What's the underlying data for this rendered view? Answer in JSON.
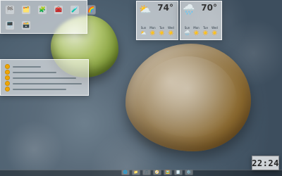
{
  "desktop": {
    "wallpaper": "river-stones"
  },
  "shortcuts": [
    {
      "icon": "🏁",
      "name": "app-icon-1"
    },
    {
      "icon": "🗂️",
      "name": "app-icon-2"
    },
    {
      "icon": "🧩",
      "name": "app-icon-3"
    },
    {
      "icon": "🧰",
      "name": "app-icon-4"
    },
    {
      "icon": "🧪",
      "name": "app-icon-5"
    },
    {
      "icon": "🌈",
      "name": "app-icon-6"
    },
    {
      "icon": "🖥️",
      "name": "app-icon-7"
    },
    {
      "icon": "🗃️",
      "name": "app-icon-8"
    }
  ],
  "weather": [
    {
      "temp": "74°",
      "now_icon": "⛅",
      "days": [
        {
          "label": "Sun",
          "icon": "⛅"
        },
        {
          "label": "Mon",
          "icon": "☀️"
        },
        {
          "label": "Tue",
          "icon": "☀️"
        },
        {
          "label": "Wed",
          "icon": "☀️"
        }
      ]
    },
    {
      "temp": "70°",
      "now_icon": "🌧️",
      "days": [
        {
          "label": "Sun",
          "icon": "🌧️"
        },
        {
          "label": "Mon",
          "icon": "☀️"
        },
        {
          "label": "Tue",
          "icon": "☀️"
        },
        {
          "label": "Wed",
          "icon": "☀️"
        }
      ]
    }
  ],
  "clock": {
    "time": "22:24"
  },
  "dock": [
    {
      "icon": "🌐",
      "name": "dock-browser"
    },
    {
      "icon": "📁",
      "name": "dock-files"
    },
    {
      "icon": "🎵",
      "name": "dock-media"
    },
    {
      "icon": "🧭",
      "name": "dock-navigator"
    },
    {
      "icon": "🖼️",
      "name": "dock-images"
    },
    {
      "icon": "🗒️",
      "name": "dock-notes"
    },
    {
      "icon": "⚙️",
      "name": "dock-settings"
    }
  ]
}
